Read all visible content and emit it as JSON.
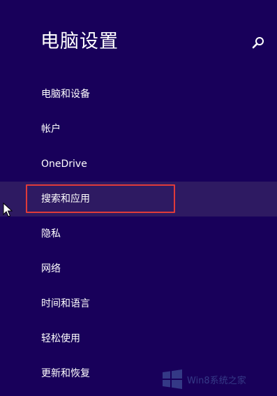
{
  "header": {
    "title": "电脑设置",
    "search_icon": "search-icon"
  },
  "menu": {
    "items": [
      {
        "label": "电脑和设备"
      },
      {
        "label": "帐户"
      },
      {
        "label": "OneDrive"
      },
      {
        "label": "搜索和应用",
        "selected": true
      },
      {
        "label": "隐私"
      },
      {
        "label": "网络"
      },
      {
        "label": "时间和语言"
      },
      {
        "label": "轻松使用"
      },
      {
        "label": "更新和恢复"
      }
    ]
  },
  "watermark": {
    "text": "Win8系统之家"
  },
  "colors": {
    "background": "#18005a",
    "selected_row": "#2e1a62",
    "highlight_border": "#e03a3a",
    "text": "#ffffff"
  }
}
